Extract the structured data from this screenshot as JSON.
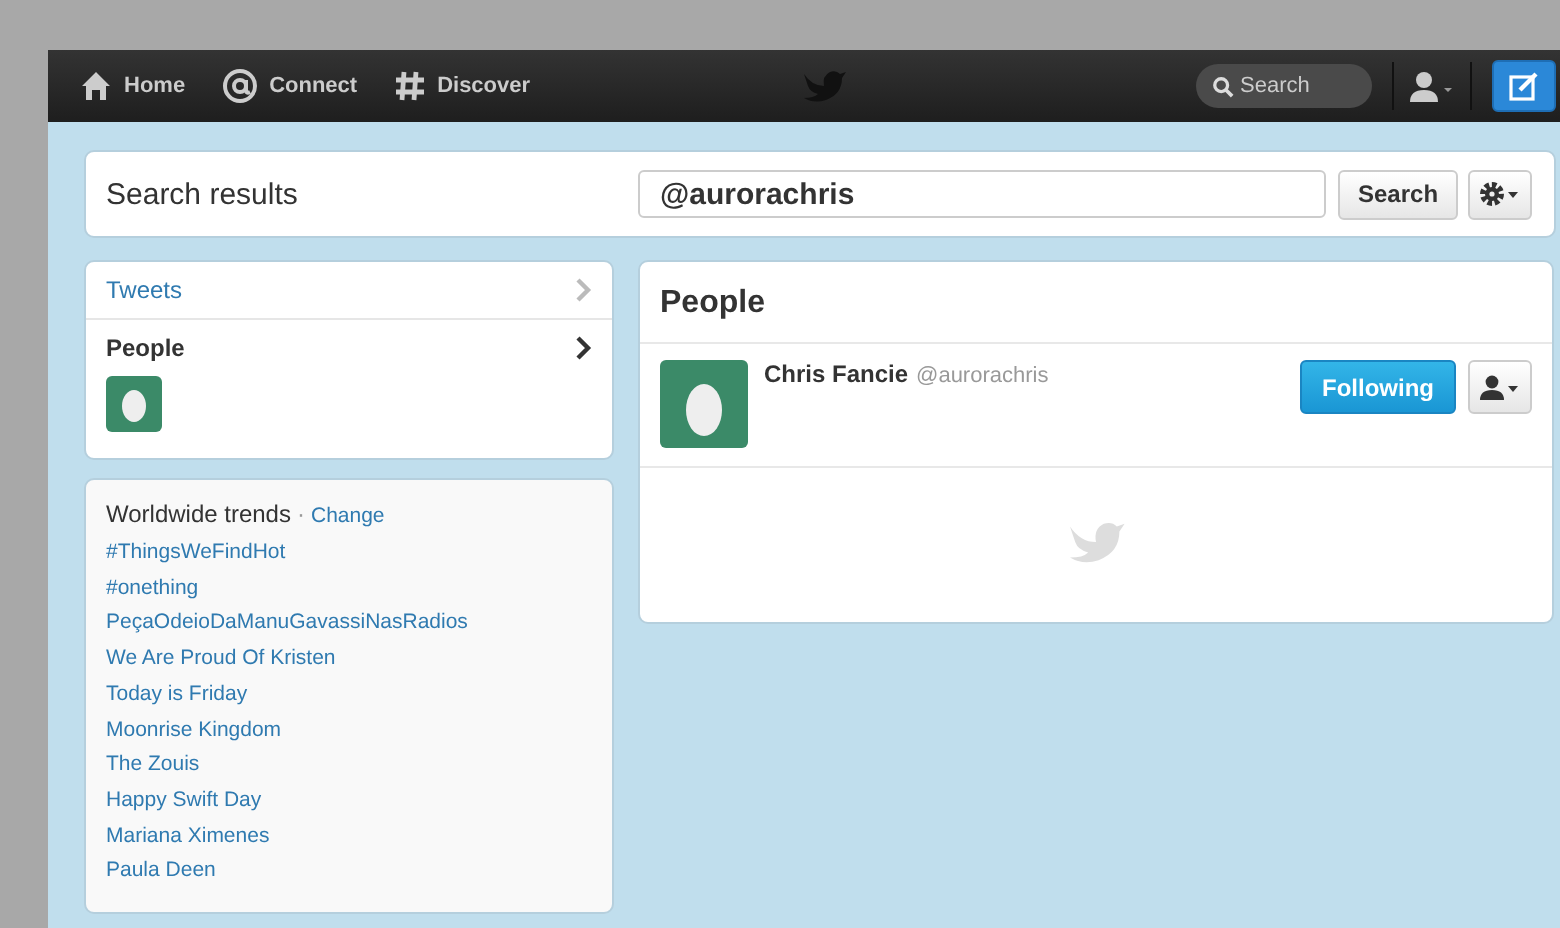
{
  "nav": {
    "items": [
      {
        "label": "Home",
        "kind": "home"
      },
      {
        "label": "Connect",
        "kind": "connect"
      },
      {
        "label": "Discover",
        "kind": "discover"
      }
    ],
    "search": {
      "placeholder": "Search"
    }
  },
  "search_header": {
    "title": "Search results",
    "query": "@aurorachris",
    "button": "Search"
  },
  "filters": [
    {
      "label": "Tweets",
      "selected": false
    },
    {
      "label": "People",
      "selected": true
    }
  ],
  "trends": {
    "title": "Worldwide trends",
    "separator": "·",
    "change": "Change",
    "items": [
      "#ThingsWeFindHot",
      "#onething",
      "PeçaOdeioDaManuGavassiNasRadios",
      "We Are Proud Of Kristen",
      "Today is Friday",
      "Moonrise Kingdom",
      "The Zouis",
      "Happy Swift Day",
      "Mariana Ximenes",
      "Paula Deen"
    ]
  },
  "people": {
    "title": "People",
    "results": [
      {
        "name": "Chris Fancie",
        "handle": "@aurorachris",
        "follow": "Following"
      }
    ]
  }
}
